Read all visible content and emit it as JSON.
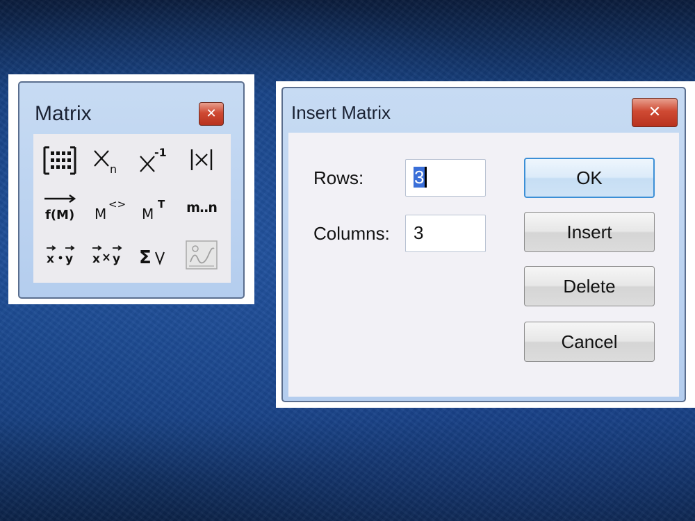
{
  "matrix_toolbar": {
    "title": "Matrix",
    "close_glyph": "✕",
    "tools": [
      {
        "name": "matrix-grid-icon",
        "label": ""
      },
      {
        "name": "subscript-icon",
        "label": ""
      },
      {
        "name": "inverse-icon",
        "label": ""
      },
      {
        "name": "determinant-icon",
        "label": ""
      },
      {
        "name": "vectorize-icon",
        "label": ""
      },
      {
        "name": "matrix-column-icon",
        "label": ""
      },
      {
        "name": "matrix-transpose-icon",
        "label": ""
      },
      {
        "name": "range-variable-icon",
        "label": "m..n"
      },
      {
        "name": "dot-product-icon",
        "label": ""
      },
      {
        "name": "cross-product-icon",
        "label": ""
      },
      {
        "name": "vector-sum-icon",
        "label": ""
      },
      {
        "name": "picture-icon",
        "label": ""
      }
    ]
  },
  "insert_dialog": {
    "title": "Insert Matrix",
    "close_glyph": "✕",
    "rows_label": "Rows:",
    "rows_value": "3",
    "columns_label": "Columns:",
    "columns_value": "3",
    "buttons": {
      "ok": "OK",
      "insert": "Insert",
      "delete": "Delete",
      "cancel": "Cancel"
    }
  },
  "colors": {
    "accent": "#3c8fd6",
    "close_red": "#cf4a33",
    "selection": "#3a6fd8"
  }
}
